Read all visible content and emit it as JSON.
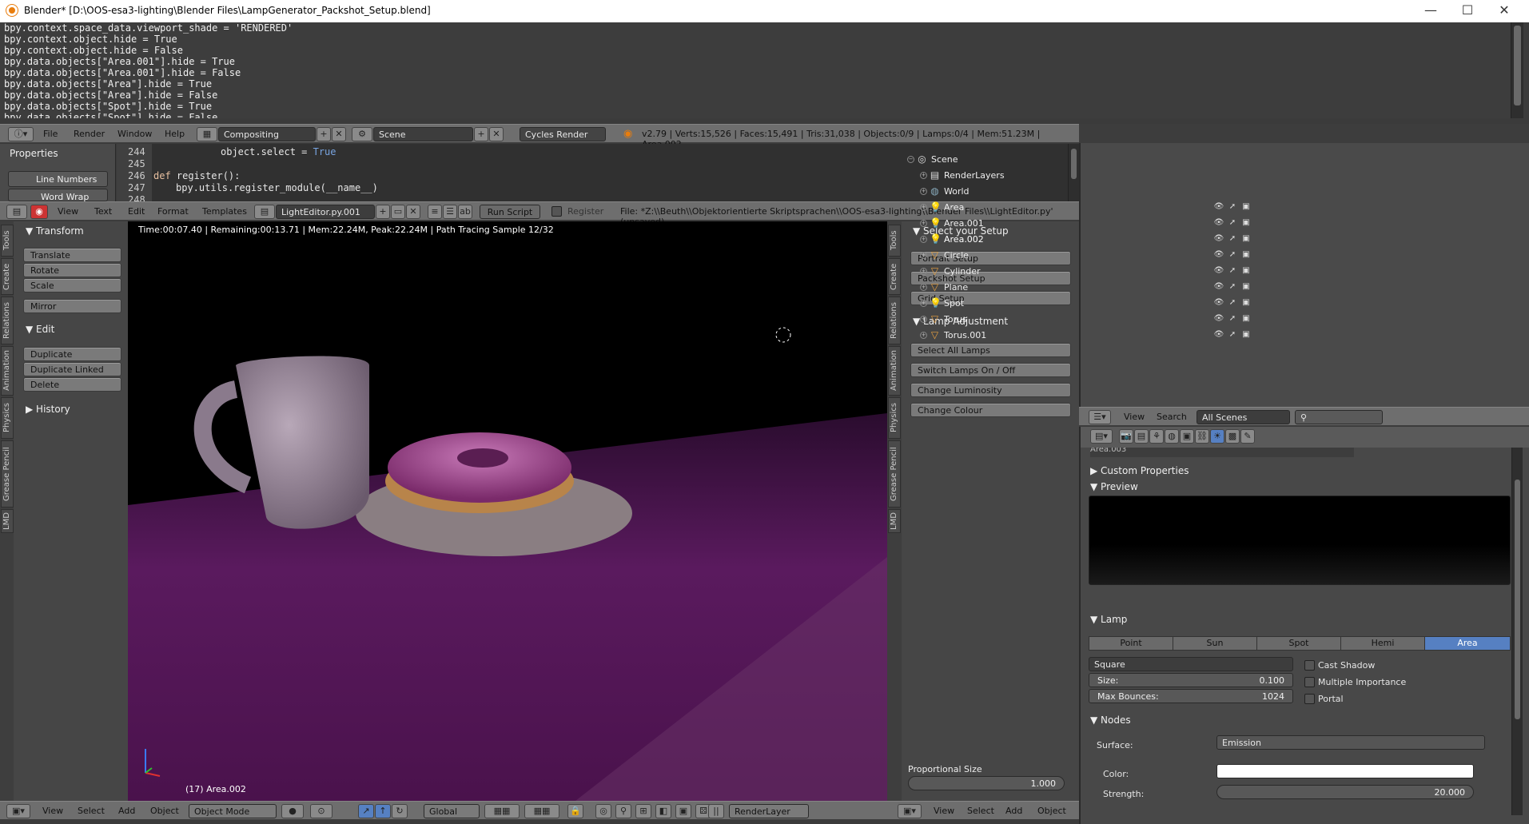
{
  "window": {
    "title": "Blender* [D:\\OOS-esa3-lighting\\Blender Files\\LampGenerator_Packshot_Setup.blend]",
    "min": "—",
    "max": "☐",
    "close": "✕"
  },
  "console": {
    "lines": [
      "bpy.context.space_data.viewport_shade = 'RENDERED'",
      "bpy.context.object.hide = True",
      "bpy.context.object.hide = False",
      "bpy.data.objects[\"Area.001\"].hide = True",
      "bpy.data.objects[\"Area.001\"].hide = False",
      "bpy.data.objects[\"Area\"].hide = True",
      "bpy.data.objects[\"Area\"].hide = False",
      "bpy.data.objects[\"Spot\"].hide = True",
      "bpy.data.objects[\"Spot\"].hide = False"
    ]
  },
  "info_header": {
    "menus": [
      "File",
      "Render",
      "Window",
      "Help"
    ],
    "layout": "Compositing",
    "scene": "Scene",
    "engine": "Cycles Render",
    "stats": "v2.79 | Verts:15,526 | Faces:15,491 | Tris:31,038 | Objects:0/9 | Lamps:0/4 | Mem:51.23M | Area.002"
  },
  "text_props": {
    "title": "Properties",
    "line_numbers": "Line Numbers",
    "word_wrap": "Word Wrap"
  },
  "code": {
    "line_nos": [
      "244",
      "245",
      "246",
      "247",
      "248"
    ],
    "l244": "object.select = ",
    "l244kw": "True",
    "l246a": "def ",
    "l246b": "register",
    "l246c": "():",
    "l247": "bpy.utils.register_module(__name__)"
  },
  "text_header": {
    "menus": [
      "View",
      "Text",
      "Edit",
      "Format",
      "Templates"
    ],
    "filename": "LightEditor.py.001",
    "run": "Run Script",
    "register": "Register",
    "file": "File: *Z:\\\\Beuth\\\\Objektorientierte Skriptsprachen\\\\OOS-esa3-lighting\\\\Blender Files\\\\LightEditor.py' (unsaved)"
  },
  "toolshelf": {
    "transform": "Transform",
    "translate": "Translate",
    "rotate": "Rotate",
    "scale": "Scale",
    "mirror": "Mirror",
    "edit": "Edit",
    "duplicate": "Duplicate",
    "duplicate_linked": "Duplicate Linked",
    "delete": "Delete",
    "history": "History",
    "tabs": [
      "Tools",
      "Create",
      "Relations",
      "Animation",
      "Physics",
      "Grease Pencil",
      "LMD"
    ]
  },
  "viewport": {
    "render_info": "Time:00:07.40 | Remaining:00:13.71 | Mem:22.24M, Peak:22.24M | Path Tracing Sample 12/32",
    "object_label": "(17) Area.002"
  },
  "right_panel": {
    "setup_title": "Select your Setup",
    "portrait": "Portrait Setup",
    "packshot": "Packshot Setup",
    "grid": "Grid Setup",
    "lamp_adj": "Lamp Adjustment",
    "select_all": "Select All Lamps",
    "switch": "Switch Lamps On / Off",
    "luminosity": "Change Luminosity",
    "colour": "Change Colour",
    "prop_size": "Proportional Size",
    "prop_value": "1.000",
    "tabs": [
      "Tools",
      "Create",
      "Relations",
      "Animation",
      "Physics",
      "Grease Pencil",
      "LMD"
    ]
  },
  "view3d_header": {
    "menus": [
      "View",
      "Select",
      "Add",
      "Object"
    ],
    "mode": "Object Mode",
    "orientation": "Global",
    "layer": "RenderLayer"
  },
  "outliner": {
    "items": [
      {
        "name": "Scene",
        "icon": "scene-icon"
      },
      {
        "name": "RenderLayers",
        "icon": "renderlayers-icon"
      },
      {
        "name": "World",
        "icon": "world-icon"
      },
      {
        "name": "Area",
        "icon": "lamp-icon"
      },
      {
        "name": "Area.001",
        "icon": "lamp-icon"
      },
      {
        "name": "Area.002",
        "icon": "lamp-icon"
      },
      {
        "name": "Circle",
        "icon": "mesh-icon"
      },
      {
        "name": "Cylinder",
        "icon": "mesh-icon"
      },
      {
        "name": "Plane",
        "icon": "mesh-icon"
      },
      {
        "name": "Spot",
        "icon": "lamp-icon"
      },
      {
        "name": "Torus",
        "icon": "mesh-icon"
      },
      {
        "name": "Torus.001",
        "icon": "mesh-icon"
      }
    ],
    "view": "View",
    "search": "Search",
    "filter": "All Scenes"
  },
  "props": {
    "datablock": "Area.003",
    "custom": "Custom Properties",
    "preview": "Preview",
    "lamp": "Lamp",
    "types": [
      "Point",
      "Sun",
      "Spot",
      "Hemi",
      "Area"
    ],
    "active_type": "Area",
    "shape": "Square",
    "size_label": "Size:",
    "size": "0.100",
    "bounces_label": "Max Bounces:",
    "bounces": "1024",
    "cast_shadow": "Cast Shadow",
    "multiple_importance": "Multiple Importance",
    "portal": "Portal",
    "nodes": "Nodes",
    "surface_label": "Surface:",
    "surface": "Emission",
    "color_label": "Color:",
    "strength_label": "Strength:",
    "strength": "20.000"
  },
  "colors": {
    "accent": "#5680c2",
    "viewport_bg": "#000000",
    "floor": "#5a1a5e"
  }
}
